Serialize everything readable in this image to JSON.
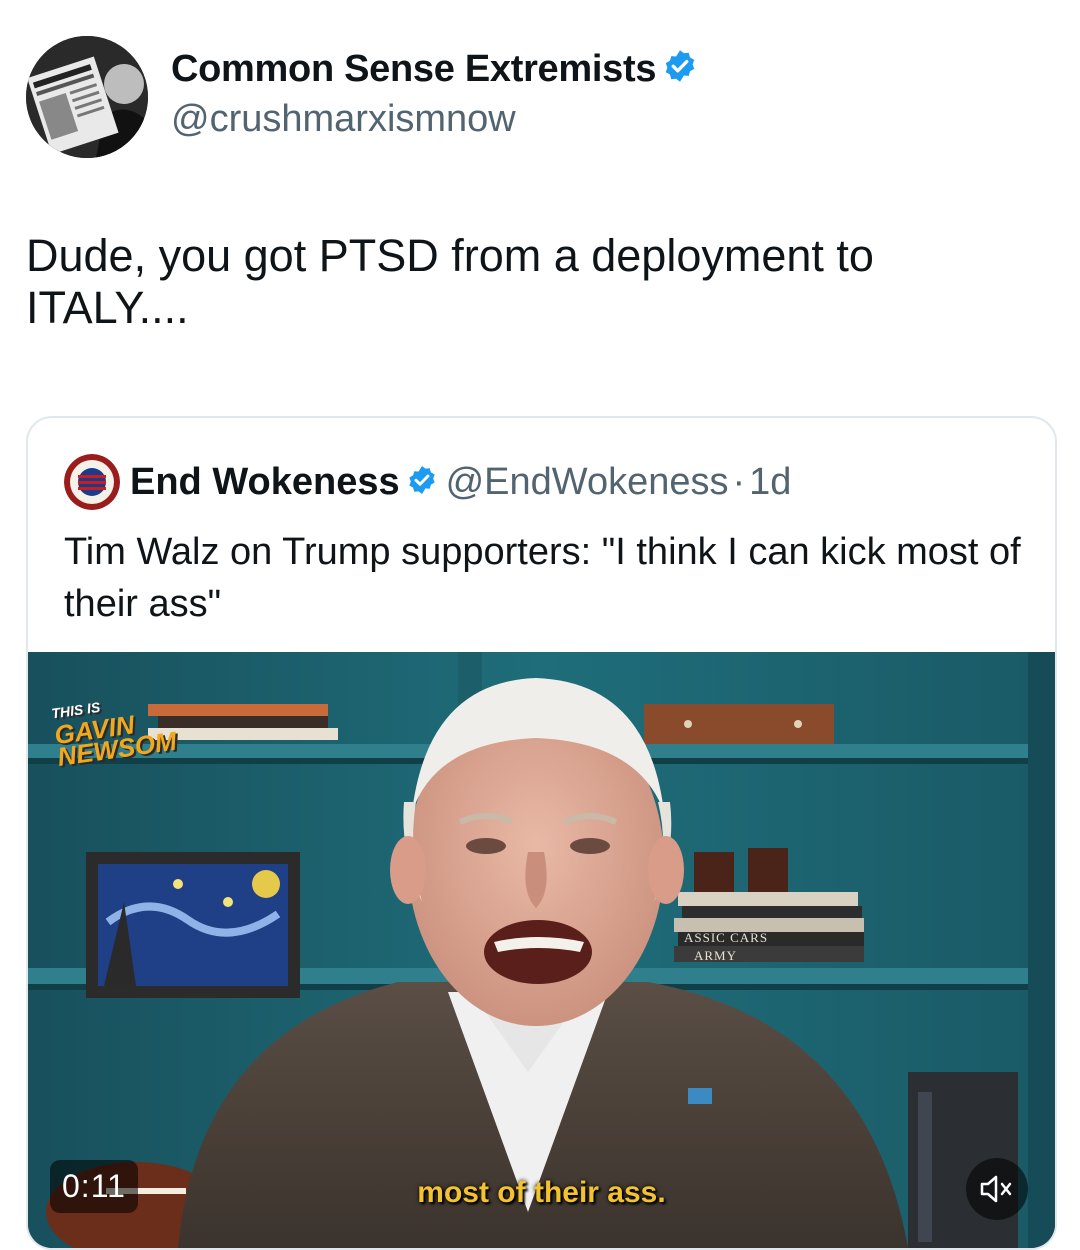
{
  "post": {
    "display_name": "Common Sense Extremists",
    "handle": "@crushmarxismnow",
    "text": "Dude, you got PTSD from a deployment to\nITALY....",
    "verified_icon": "verified-badge-icon",
    "accent_color": "#1d9bf0"
  },
  "quote": {
    "display_name": "End Wokeness",
    "handle": "@EndWokeness",
    "separator": "·",
    "age": "1d",
    "text": "Tim Walz on Trump supporters: \"I think I can kick most of their ass\""
  },
  "video": {
    "timer": "0:11",
    "caption": "most of their ass.",
    "mute_icon": "volume-muted-icon",
    "watermark_line1": "THIS IS",
    "watermark_line2": "GAVIN",
    "watermark_line3": "NEWSOM",
    "book_label_1": "ASSIC CARS",
    "book_label_2": "ARMY"
  }
}
